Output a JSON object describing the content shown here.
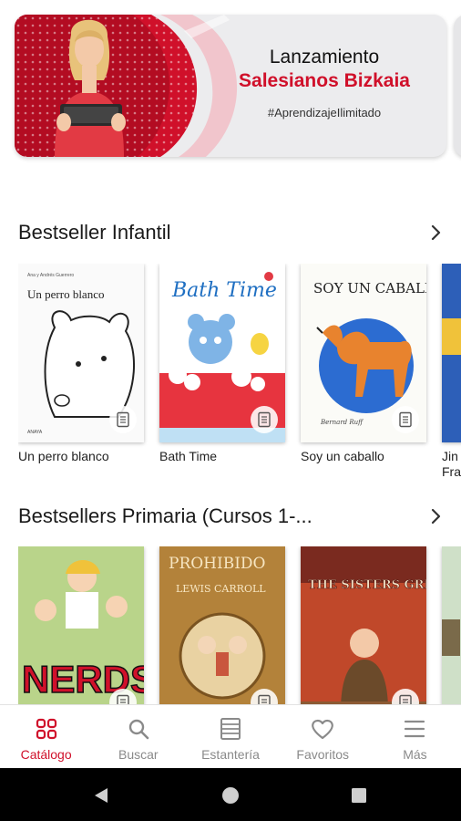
{
  "banner": {
    "title": "Lanzamiento",
    "subtitle": "Salesianos Bizkaia",
    "hashtag": "#AprendizajeIlimitado"
  },
  "sections": [
    {
      "title": "Bestseller Infantil",
      "books": [
        {
          "label": "Un perro blanco",
          "cover_title": "Un perro blanco",
          "cover_author": "Ana y Andrés Guerrero",
          "cover_publisher": "ANAYA"
        },
        {
          "label": "Bath Time",
          "cover_title": "Bath Time"
        },
        {
          "label": "Soy un caballo",
          "cover_title": "SOY UN CABALLO"
        },
        {
          "label": "Jin\nFra"
        }
      ]
    },
    {
      "title": "Bestsellers Primaria (Cursos 1-...",
      "books": [
        {
          "cover_title": "NERDS"
        },
        {
          "cover_title": "PROHIBIDO",
          "cover_subtitle": "LEWIS CARROLL"
        },
        {
          "cover_title": "THE SISTERS GRIMM"
        },
        {}
      ]
    }
  ],
  "nav": [
    {
      "label": "Catálogo",
      "icon": "grid-icon",
      "active": true
    },
    {
      "label": "Buscar",
      "icon": "search-icon",
      "active": false
    },
    {
      "label": "Estantería",
      "icon": "shelf-icon",
      "active": false
    },
    {
      "label": "Favoritos",
      "icon": "heart-icon",
      "active": false
    },
    {
      "label": "Más",
      "icon": "menu-icon",
      "active": false
    }
  ],
  "colors": {
    "accent": "#d0102a",
    "inactive": "#8a8a8a"
  }
}
